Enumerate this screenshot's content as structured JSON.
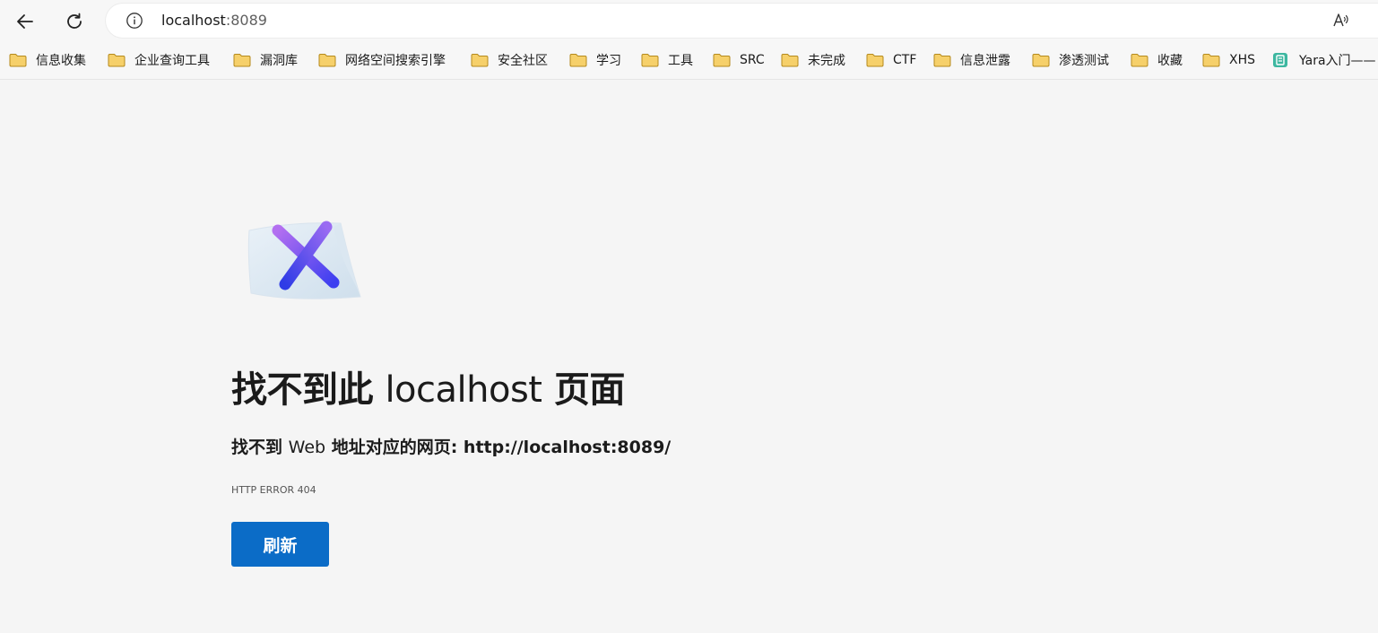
{
  "browser": {
    "back_icon": "arrow-left-icon",
    "refresh_icon": "refresh-icon",
    "address": {
      "info_icon": "info-icon",
      "host": "localhost",
      "port": ":8089",
      "read_aloud_icon": "read-aloud-icon"
    }
  },
  "bookmarks": {
    "items": [
      {
        "label": "信息收集",
        "icon": "folder-icon"
      },
      {
        "label": "企业查询工具",
        "icon": "folder-icon"
      },
      {
        "label": "漏洞库",
        "icon": "folder-icon"
      },
      {
        "label": "网络空间搜索引擎",
        "icon": "folder-icon"
      },
      {
        "label": "安全社区",
        "icon": "folder-icon"
      },
      {
        "label": "学习",
        "icon": "folder-icon"
      },
      {
        "label": "工具",
        "icon": "folder-icon"
      },
      {
        "label": "SRC",
        "icon": "folder-icon"
      },
      {
        "label": "未完成",
        "icon": "folder-icon"
      },
      {
        "label": "CTF",
        "icon": "folder-icon"
      },
      {
        "label": "信息泄露",
        "icon": "folder-icon"
      },
      {
        "label": "渗透测试",
        "icon": "folder-icon"
      },
      {
        "label": "收藏",
        "icon": "folder-icon"
      },
      {
        "label": "XHS",
        "icon": "folder-icon"
      },
      {
        "label": "Yara入门——",
        "icon": "document-icon"
      }
    ]
  },
  "error_page": {
    "illustration": "error-x-icon",
    "title_prefix": "找不到此",
    "title_host": "localhost",
    "title_suffix": "页面",
    "subtitle_prefix": "找不到",
    "subtitle_web": "Web",
    "subtitle_rest": "地址对应的网页: http://localhost:8089/",
    "error_code": "HTTP ERROR 404",
    "refresh_label": "刷新"
  },
  "colors": {
    "accent": "#0b6cc7",
    "background": "#f5f5f5",
    "folder": "#f3c44e"
  }
}
